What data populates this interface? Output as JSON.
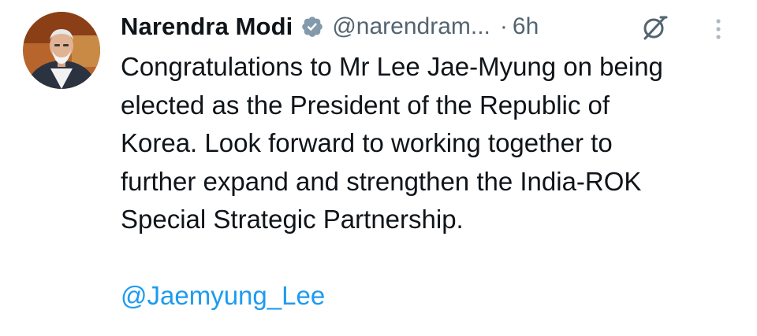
{
  "tweet": {
    "author_name": "Narendra Modi",
    "handle": "@narendram...",
    "separator": "·",
    "time": "6h",
    "text_lines": [
      "Congratulations to Mr Lee Jae-Myung on being",
      "elected as the President of the Republic of",
      "Korea.  Look forward to working together to",
      "further expand and strengthen the India-ROK",
      "Special Strategic Partnership."
    ],
    "mention": "@Jaemyung_Lee"
  },
  "icons": {
    "avatar": "profile-photo",
    "verified": "verified-badge-icon",
    "grok": "grok-icon",
    "more": "more-vertical-icon"
  },
  "colors": {
    "text": "#0f1419",
    "secondary": "#536471",
    "link": "#1d9bf0",
    "verified_badge": "#829aab"
  }
}
